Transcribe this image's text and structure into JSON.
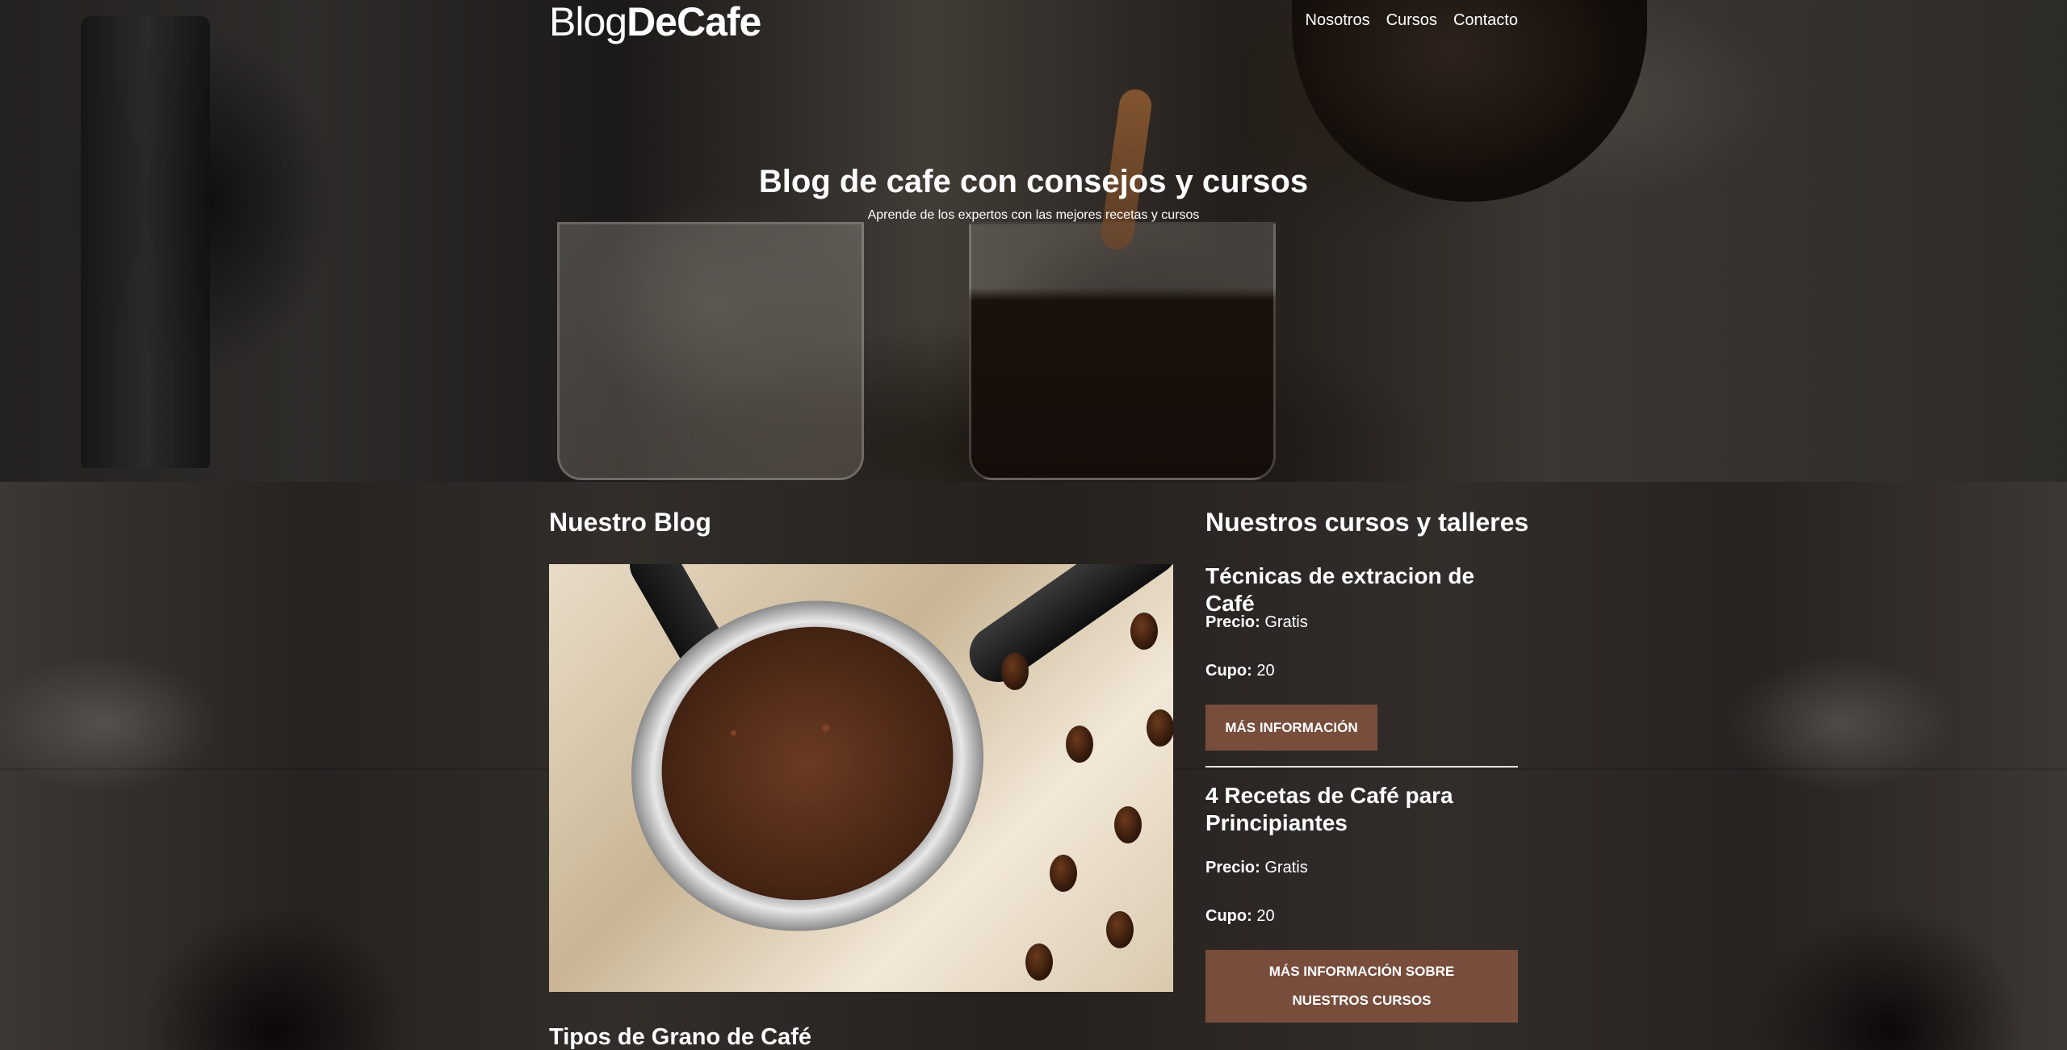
{
  "header": {
    "logo_light": "Blog",
    "logo_bold": "DeCafe",
    "nav": [
      {
        "label": "Nosotros"
      },
      {
        "label": "Cursos"
      },
      {
        "label": "Contacto"
      }
    ]
  },
  "hero": {
    "title": "Blog de cafe con consejos y cursos",
    "subtitle": "Aprende de los expertos con las mejores recetas y cursos"
  },
  "blog": {
    "heading": "Nuestro Blog",
    "next_post_title": "Tipos de Grano de Café"
  },
  "courses": {
    "heading": "Nuestros cursos y talleres",
    "items": [
      {
        "title": "Técnicas de extracion de Café",
        "price_label": "Precio:",
        "price": "Gratis",
        "quota_label": "Cupo:",
        "quota": "20",
        "button": "Más Información"
      },
      {
        "title": "4 Recetas de Café para Principiantes",
        "price_label": "Precio:",
        "price": "Gratis",
        "quota_label": "Cupo:",
        "quota": "20"
      }
    ],
    "more_button": "Más Información sobre nuestros cursos"
  },
  "colors": {
    "button": "#784d3c",
    "text": "#ffffff"
  }
}
